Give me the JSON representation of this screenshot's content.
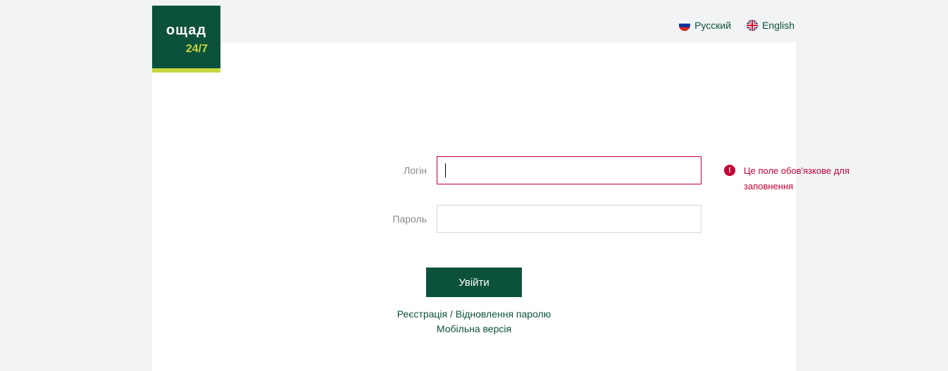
{
  "logo": {
    "line1": "ощад",
    "line2": "24/7"
  },
  "languages": {
    "ru": "Русский",
    "en": "English"
  },
  "form": {
    "login_label": "Логін",
    "login_value": "",
    "password_label": "Пароль",
    "password_value": "",
    "submit_label": "Увійти",
    "error_message": "Це поле обов'язкове для заповнення"
  },
  "links": {
    "register": "Реєстрація / Відновлення паролю",
    "mobile": "Мобільна версія"
  }
}
